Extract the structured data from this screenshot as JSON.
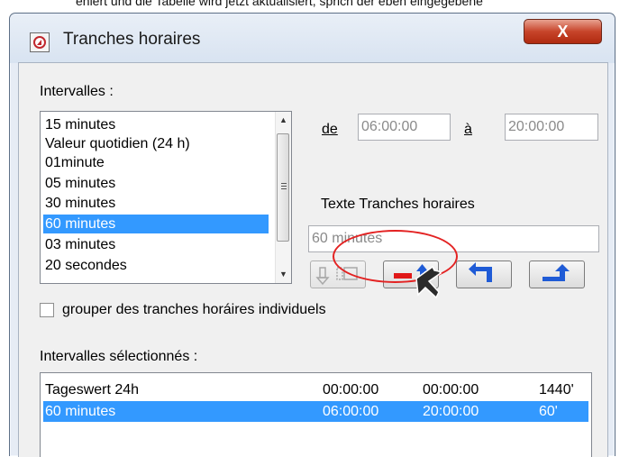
{
  "caption_fragment": "eniert und die Tabelle wird jetzt aktualisiert, sprich der eben eingegebene",
  "window": {
    "title": "Tranches horaires",
    "close_glyph": "X"
  },
  "intervals": {
    "label": "Intervalles :",
    "items": [
      "15 minutes",
      "Valeur quotidien (24 h)",
      "01minute",
      "05 minutes",
      "30 minutes",
      "60 minutes",
      "03 minutes",
      "20 secondes"
    ],
    "selected": "60 minutes"
  },
  "time_range": {
    "from_label": "de",
    "from_value": "06:00:00",
    "to_label": "à",
    "to_value": "20:00:00"
  },
  "text_field": {
    "label": "Texte Tranches horaires",
    "value": "60 minutes"
  },
  "toolbar": {
    "buttons": [
      "insert-disabled-icon",
      "remove-and-apply-icon",
      "move-left-icon",
      "move-up-icon"
    ],
    "highlighted": "remove-and-apply-icon"
  },
  "group_checkbox": {
    "label": "grouper des tranches horáires individuels",
    "checked": false
  },
  "selected_intervals": {
    "label": "Intervalles sélectionnés :",
    "rows": [
      {
        "name": "Tageswert 24h",
        "start": "00:00:00",
        "end": "00:00:00",
        "duration": "1440'"
      },
      {
        "name": "60 minutes",
        "start": "06:00:00",
        "end": "20:00:00",
        "duration": "60'"
      }
    ],
    "selected_index": 1
  },
  "colors": {
    "selection": "#3399ff",
    "annotation": "#e32222",
    "close": "#c7442a",
    "arrow_blue": "#1f5bd6",
    "arrow_red": "#e01818"
  }
}
